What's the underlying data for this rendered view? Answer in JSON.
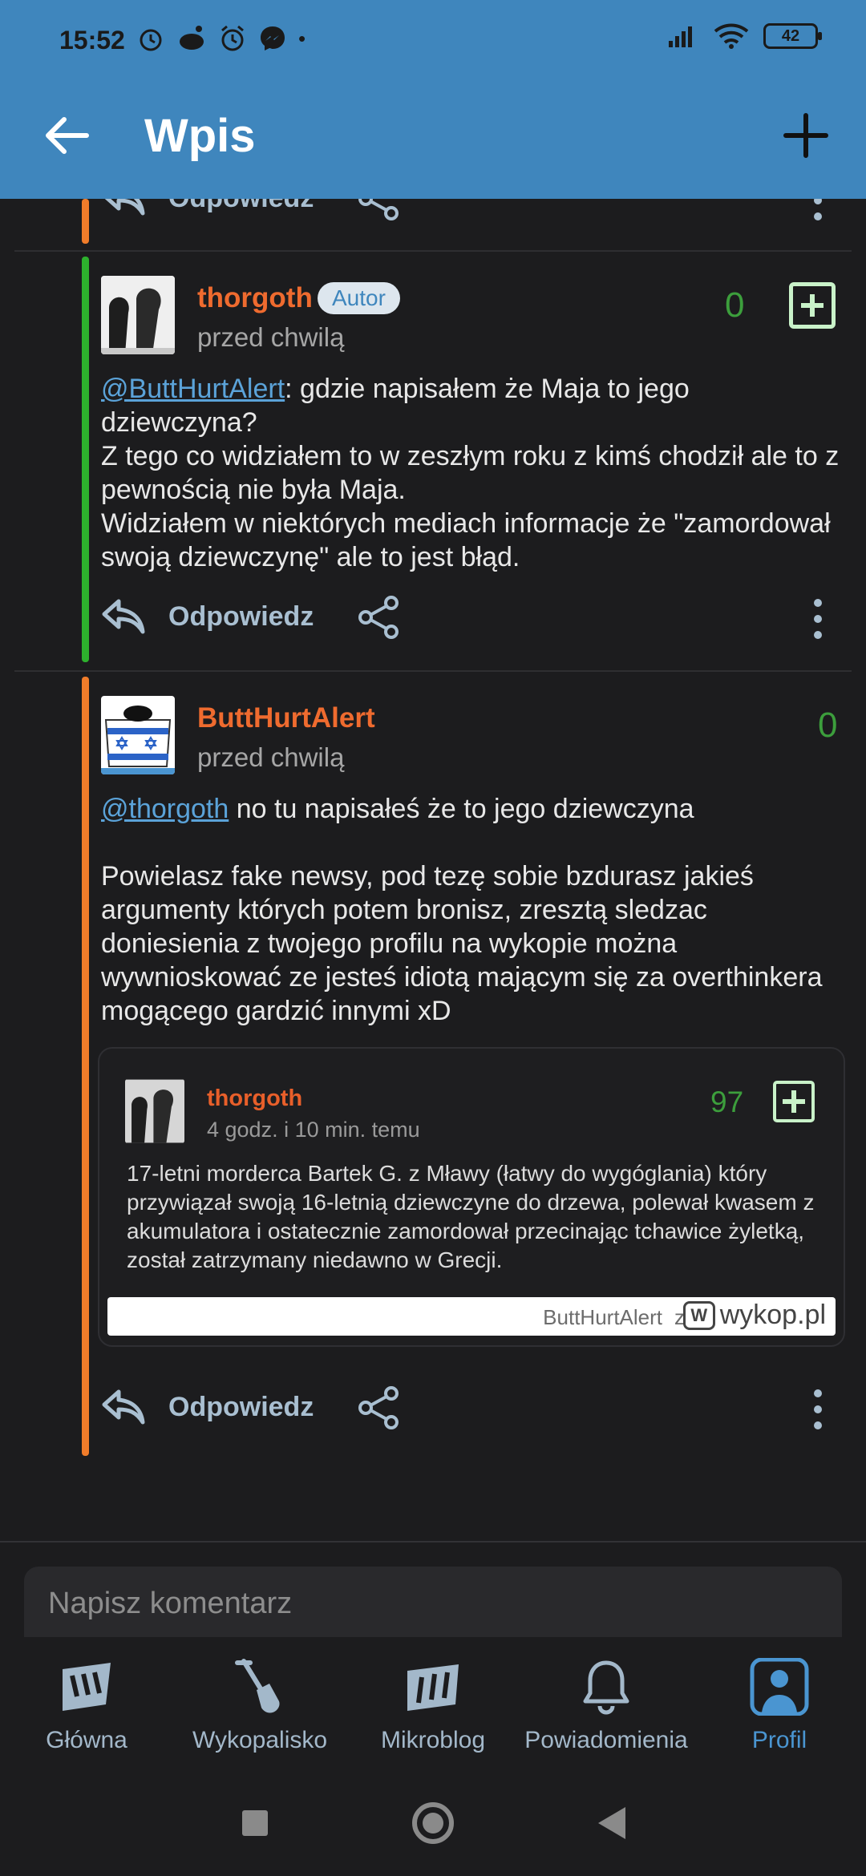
{
  "status_bar": {
    "time": "15:52",
    "battery": "42"
  },
  "app_bar": {
    "title": "Wpis"
  },
  "colors": {
    "header": "#3f86bd",
    "author_accent": "#2db02d",
    "thread_accent": "#f07c2a",
    "username": "#ef6b2f",
    "score": "#3c9e3c",
    "link": "#5ba3d9"
  },
  "entries": [
    {
      "username": "thorgoth",
      "badge": "Autor",
      "time": "przed chwilą",
      "score": "0",
      "mention": "@ButtHurtAlert",
      "text_after_mention": ": gdzie napisałem że Maja to jego dziewczyna?",
      "lines": [
        "Z tego co widziałem to w zeszłym roku z kimś chodził ale to z pewnością nie była Maja.",
        "Widziałem w niektórych mediach informacje że \"zamordował swoją dziewczynę\" ale to jest błąd."
      ]
    },
    {
      "username": "ButtHurtAlert",
      "time": "przed chwilą",
      "score": "0",
      "mention": "@thorgoth",
      "text_after_mention": " no tu napisałeś że to jego dziewczyna",
      "paragraph": "Powielasz fake newsy, pod tezę sobie bzdurasz jakieś argumenty których potem bronisz, zresztą sledzac doniesienia z twojego profilu na wykopie można wywnioskować ze jesteś idiotą mającym się za overthinkera mogącego gardzić innymi xD",
      "embed": {
        "username": "thorgoth",
        "time": "4 godz. i 10 min. temu",
        "score": "97",
        "text": "17-letni morderca Bartek G. z Mławy (łatwy do wygóglania) który przywiązał swoją 16-letnią dziewczyne do drzewa, polewał kwasem z akumulatora i ostatecznie zamordował przecinając tchawice żyletką, został zatrzymany niedawno w Grecji.",
        "footer_user": "ButtHurtAlert",
        "footer_z": "z",
        "footer_site": "wykop.pl"
      }
    }
  ],
  "actions": {
    "reply": "Odpowiedz"
  },
  "comment": {
    "placeholder": "Napisz komentarz"
  },
  "nav": [
    {
      "label": "Główna",
      "icon": "home-w-icon"
    },
    {
      "label": "Wykopalisko",
      "icon": "shovel-icon"
    },
    {
      "label": "Mikroblog",
      "icon": "mikroblog-m-icon"
    },
    {
      "label": "Powiadomienia",
      "icon": "bell-icon"
    },
    {
      "label": "Profil",
      "icon": "profile-icon",
      "active": true
    }
  ]
}
